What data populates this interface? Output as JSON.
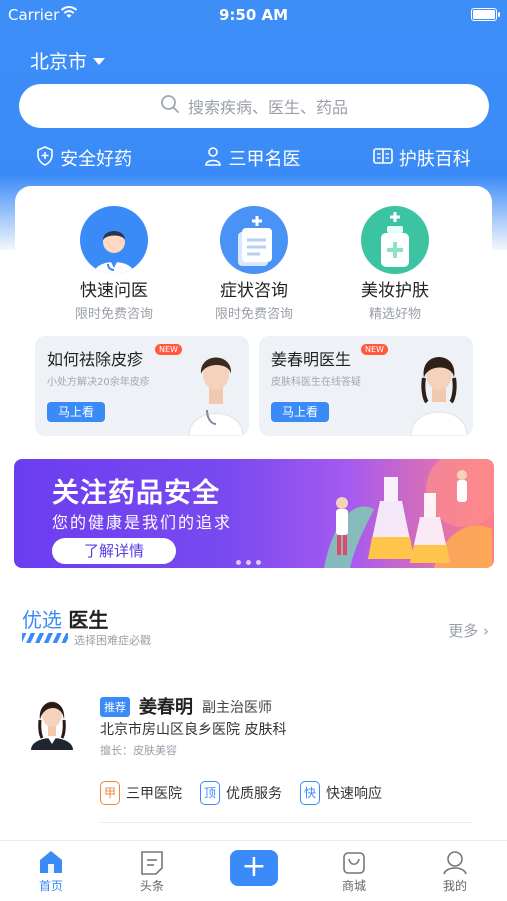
{
  "status_bar": {
    "carrier": "Carrier",
    "time": "9:50 AM"
  },
  "header": {
    "city": "北京市",
    "search_placeholder": "搜索疾病、医生、药品"
  },
  "features": [
    {
      "icon": "shield-icon",
      "label": "安全好药"
    },
    {
      "icon": "doctor-icon",
      "label": "三甲名医"
    },
    {
      "icon": "book-icon",
      "label": "护肤百科"
    }
  ],
  "services": [
    {
      "title": "快速问医",
      "sub": "限时免费咨询"
    },
    {
      "title": "症状咨询",
      "sub": "限时免费咨询"
    },
    {
      "title": "美妆护肤",
      "sub": "精选好物"
    }
  ],
  "promos": [
    {
      "title": "如何祛除皮疹",
      "badge": "NEW",
      "sub": "小处方解决20余年皮疹",
      "button": "马上看"
    },
    {
      "title": "姜春明医生",
      "badge": "NEW",
      "sub": "皮肤科医生在线答疑",
      "button": "马上看"
    }
  ],
  "banner": {
    "title": "关注药品安全",
    "subtitle": "您的健康是我们的追求",
    "button": "了解详情"
  },
  "section": {
    "title_a": "优选",
    "title_b": "医生",
    "subtitle": "选择困难症必戳",
    "more": "更多"
  },
  "doctor": {
    "tag": "推荐",
    "name": "姜春明",
    "title": "副主治医师",
    "hospital": "北京市房山区良乡医院 皮肤科",
    "specialty": "擅长：皮肤美容",
    "badges": [
      {
        "icon": "甲",
        "label": "三甲医院",
        "color": "#f0833a"
      },
      {
        "icon": "顶",
        "label": "优质服务",
        "color": "#3a8bf7"
      },
      {
        "icon": "快",
        "label": "快速响应",
        "color": "#3a8bf7"
      }
    ]
  },
  "tabbar": [
    {
      "label": "首页",
      "active": true
    },
    {
      "label": "头条",
      "active": false
    },
    {
      "label": "商城",
      "active": false
    },
    {
      "label": "我的",
      "active": false
    }
  ],
  "colors": {
    "primary": "#3a8bf7",
    "banner_start": "#6a3df0",
    "new_badge": "#ff5a3c"
  }
}
